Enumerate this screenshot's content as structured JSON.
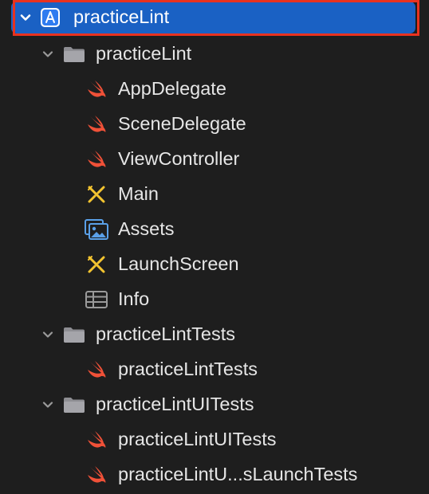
{
  "navigator": {
    "colors": {
      "selection": "#1a61c4",
      "highlight_border": "#e8321f",
      "swift_orange": "#f05138",
      "ib_yellow": "#f4c430",
      "assets_blue": "#5aa0e8",
      "folder_gray": "#8e8e93",
      "text": "#e6e6e6"
    },
    "project": {
      "label": "practiceLint",
      "icon": "xcode-project-icon",
      "expanded": true
    },
    "groups": [
      {
        "label": "practiceLint",
        "icon": "folder-icon",
        "expanded": true,
        "files": [
          {
            "label": "AppDelegate",
            "icon": "swift-icon"
          },
          {
            "label": "SceneDelegate",
            "icon": "swift-icon"
          },
          {
            "label": "ViewController",
            "icon": "swift-icon"
          },
          {
            "label": "Main",
            "icon": "storyboard-icon"
          },
          {
            "label": "Assets",
            "icon": "asset-catalog-icon"
          },
          {
            "label": "LaunchScreen",
            "icon": "storyboard-icon"
          },
          {
            "label": "Info",
            "icon": "plist-icon"
          }
        ]
      },
      {
        "label": "practiceLintTests",
        "icon": "folder-icon",
        "expanded": true,
        "files": [
          {
            "label": "practiceLintTests",
            "icon": "swift-icon"
          }
        ]
      },
      {
        "label": "practiceLintUITests",
        "icon": "folder-icon",
        "expanded": true,
        "files": [
          {
            "label": "practiceLintUITests",
            "icon": "swift-icon"
          },
          {
            "label": "practiceLintU...sLaunchTests",
            "icon": "swift-icon"
          }
        ]
      }
    ]
  }
}
